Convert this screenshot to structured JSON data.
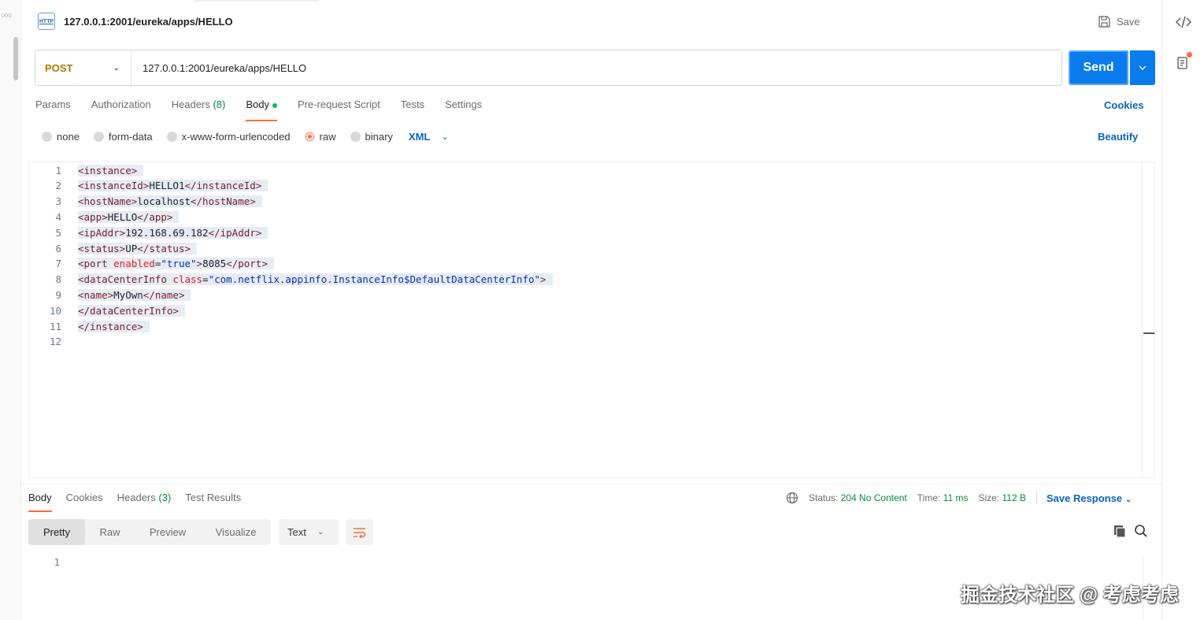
{
  "request": {
    "title": "127.0.0.1:2001/eureka/apps/HELLO",
    "http_icon": "HTTP",
    "save_label": "Save",
    "method": "POST",
    "url": "127.0.0.1:2001/eureka/apps/HELLO",
    "send_label": "Send"
  },
  "tabs": [
    {
      "label": "Params"
    },
    {
      "label": "Authorization"
    },
    {
      "label": "Headers",
      "count": "(8)"
    },
    {
      "label": "Body"
    },
    {
      "label": "Pre-request Script"
    },
    {
      "label": "Tests"
    },
    {
      "label": "Settings"
    }
  ],
  "cookies_label": "Cookies",
  "body_types": [
    "none",
    "form-data",
    "x-www-form-urlencoded",
    "raw",
    "binary"
  ],
  "body_language": "XML",
  "beautify_label": "Beautify",
  "code_lines": [
    {
      "n": "1",
      "parts": [
        [
          "tag",
          "<instance>"
        ]
      ]
    },
    {
      "n": "2",
      "parts": [
        [
          "tag",
          "<instanceId>"
        ],
        [
          "ttxt",
          "HELLO1"
        ],
        [
          "tag",
          "</instanceId>"
        ]
      ]
    },
    {
      "n": "3",
      "parts": [
        [
          "tag",
          "<hostName>"
        ],
        [
          "ttxt",
          "localhost"
        ],
        [
          "tag",
          "</hostName>"
        ]
      ]
    },
    {
      "n": "4",
      "parts": [
        [
          "tag",
          "<app>"
        ],
        [
          "ttxt",
          "HELLO"
        ],
        [
          "tag",
          "</app>"
        ]
      ]
    },
    {
      "n": "5",
      "parts": [
        [
          "tag",
          "<ipAddr>"
        ],
        [
          "ttxt",
          "192.168.69.182"
        ],
        [
          "tag",
          "</ipAddr>"
        ]
      ]
    },
    {
      "n": "6",
      "parts": [
        [
          "tag",
          "<status>"
        ],
        [
          "ttxt",
          "UP"
        ],
        [
          "tag",
          "</status>"
        ]
      ]
    },
    {
      "n": "7",
      "parts": [
        [
          "tag",
          "<port "
        ],
        [
          "attr",
          "enabled"
        ],
        [
          "ttxt",
          "="
        ],
        [
          "aval",
          "\"true\""
        ],
        [
          "tag",
          ">"
        ],
        [
          "ttxt",
          "8085"
        ],
        [
          "tag",
          "</port>"
        ]
      ]
    },
    {
      "n": "8",
      "parts": [
        [
          "tag",
          "<dataCenterInfo "
        ],
        [
          "attr",
          "class"
        ],
        [
          "ttxt",
          "="
        ],
        [
          "aval",
          "\"com.netflix.appinfo.InstanceInfo$DefaultDataCenterInfo\""
        ],
        [
          "tag",
          ">"
        ]
      ]
    },
    {
      "n": "9",
      "parts": [
        [
          "tag",
          "<name>"
        ],
        [
          "ttxt",
          "MyOwn"
        ],
        [
          "tag",
          "</name>"
        ]
      ]
    },
    {
      "n": "10",
      "parts": [
        [
          "tag",
          "</dataCenterInfo>"
        ]
      ]
    },
    {
      "n": "11",
      "parts": [
        [
          "tag",
          "</instance>"
        ]
      ]
    },
    {
      "n": "12",
      "parts": []
    }
  ],
  "response": {
    "tabs": [
      {
        "label": "Body"
      },
      {
        "label": "Cookies"
      },
      {
        "label": "Headers",
        "count": "(3)"
      },
      {
        "label": "Test Results"
      }
    ],
    "status_label": "Status:",
    "status_value": "204 No Content",
    "time_label": "Time:",
    "time_value": "11 ms",
    "size_label": "Size:",
    "size_value": "112 B",
    "save_response_label": "Save Response",
    "views": [
      "Pretty",
      "Raw",
      "Preview",
      "Visualize"
    ],
    "format": "Text",
    "line_number": "1"
  },
  "watermark": "掘金技术社区 @ 考虑考虑",
  "colors": {
    "accent": "#ff6c37",
    "send": "#097bed",
    "link": "#0b63c4",
    "method": "#ad7a03",
    "status_ok": "#0a8a3b"
  }
}
